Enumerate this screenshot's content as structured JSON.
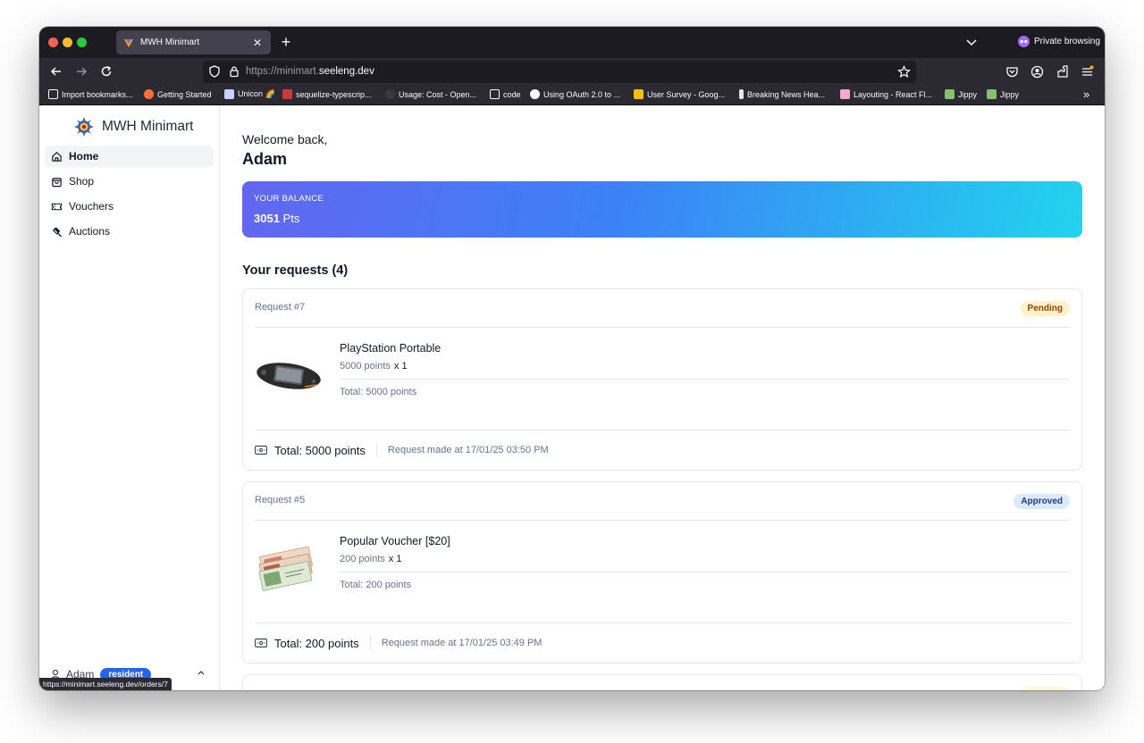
{
  "browser": {
    "tab_title": "MWH Minimart",
    "private_label": "Private browsing",
    "url_prefix": "https://minimart.",
    "url_domain": "seeleng.dev",
    "bookmarks": [
      "Import bookmarks...",
      "Getting Started",
      "Unicon 🌈",
      "sequelize-typescrip...",
      "Usage: Cost - Open...",
      "code",
      "Using OAuth 2.0 to ...",
      "User Survey - Goog...",
      "Breaking News Hea...",
      "Layouting - React Fl...",
      "Jippy",
      "Jippy"
    ],
    "more_label": "»",
    "status_url": "https://minimart.seeleng.dev/orders/7"
  },
  "sidebar": {
    "brand": "MWH Minimart",
    "items": [
      {
        "label": "Home",
        "icon": "home-icon",
        "active": true
      },
      {
        "label": "Shop",
        "icon": "shopping-bag-icon",
        "active": false
      },
      {
        "label": "Vouchers",
        "icon": "ticket-icon",
        "active": false
      },
      {
        "label": "Auctions",
        "icon": "gavel-icon",
        "active": false
      }
    ],
    "user_name": "Adam",
    "user_role": "resident"
  },
  "main": {
    "welcome": "Welcome back,",
    "user_name": "Adam",
    "balance_label": "YOUR BALANCE",
    "balance_value": "3051",
    "balance_unit": "Pts",
    "requests_title": "Your requests (4)"
  },
  "requests": [
    {
      "title": "Request #7",
      "status": "Pending",
      "item_name": "PlayStation Portable",
      "item_price": "5000 points",
      "item_qty": "x 1",
      "item_total": "Total: 5000 points",
      "total": "Total: 5000 points",
      "made_at": "Request made at 17/01/25 03:50 PM"
    },
    {
      "title": "Request #5",
      "status": "Approved",
      "item_name": "Popular Voucher [$20]",
      "item_price": "200 points",
      "item_qty": "x 1",
      "item_total": "Total: 200 points",
      "total": "Total: 200 points",
      "made_at": "Request made at 17/01/25 03:49 PM"
    }
  ],
  "colors": {
    "accent": "#2563eb",
    "balance_gradient_start": "#6366f1",
    "balance_gradient_end": "#22d3ee",
    "pending_bg": "#fef3c7",
    "approved_bg": "#dbeafe"
  }
}
